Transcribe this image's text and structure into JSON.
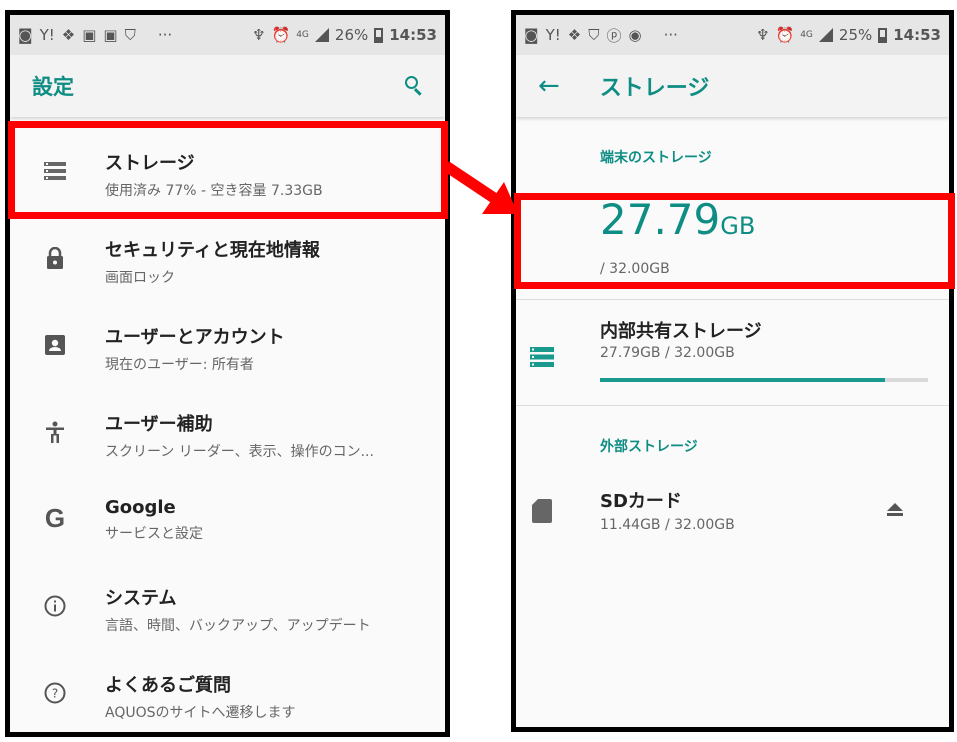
{
  "left_screen": {
    "status": {
      "battery": "26%",
      "time": "14:53",
      "network": "4G"
    },
    "appbar": {
      "title": "設定"
    },
    "items": [
      {
        "icon": "storage-icon",
        "title": "ストレージ",
        "subtitle": "使用済み 77% - 空き容量 7.33GB"
      },
      {
        "icon": "lock-icon",
        "title": "セキュリティと現在地情報",
        "subtitle": "画面ロック"
      },
      {
        "icon": "account-box-icon",
        "title": "ユーザーとアカウント",
        "subtitle": "現在のユーザー: 所有者"
      },
      {
        "icon": "accessibility-icon",
        "title": "ユーザー補助",
        "subtitle": "スクリーン リーダー、表示、操作のコン..."
      },
      {
        "icon": "google-icon",
        "title": "Google",
        "subtitle": "サービスと設定"
      },
      {
        "icon": "info-icon",
        "title": "システム",
        "subtitle": "言語、時間、バックアップ、アップデート"
      },
      {
        "icon": "help-icon",
        "title": "よくあるご質問",
        "subtitle": "AQUOSのサイトへ遷移します"
      }
    ]
  },
  "right_screen": {
    "status": {
      "battery": "25%",
      "time": "14:53",
      "network": "4G"
    },
    "appbar": {
      "title": "ストレージ"
    },
    "device_section_label": "端末のストレージ",
    "used_number": "27.79",
    "used_unit": "GB",
    "total": "/ 32.00GB",
    "internal": {
      "name": "内部共有ストレージ",
      "usage": "27.79GB / 32.00GB",
      "fraction_used": 0.868
    },
    "external_section_label": "外部ストレージ",
    "sdcard": {
      "name": "SDカード",
      "usage": "11.44GB / 32.00GB"
    }
  },
  "colors": {
    "accent": "#0e8d84",
    "highlight": "#ff0000",
    "progress": "#1a9a8f"
  }
}
